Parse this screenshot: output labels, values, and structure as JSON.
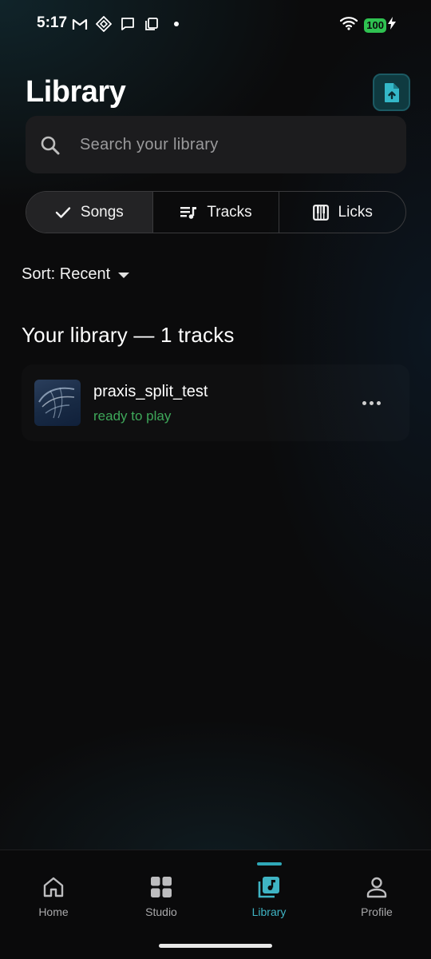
{
  "status_bar": {
    "time": "5:17",
    "battery": "100",
    "icons": [
      "gmail-icon",
      "diamond-app-icon",
      "message-icon",
      "copy-icon",
      "dot-icon",
      "wifi-icon",
      "battery-icon",
      "charging-icon"
    ]
  },
  "header": {
    "title": "Library",
    "upload_icon": "file-upload-icon"
  },
  "search": {
    "placeholder": "Search your library",
    "value": ""
  },
  "segments": [
    {
      "label": "Songs",
      "icon": "check-icon",
      "active": true
    },
    {
      "label": "Tracks",
      "icon": "playlist-music-icon",
      "active": false
    },
    {
      "label": "Licks",
      "icon": "piano-icon",
      "active": false
    }
  ],
  "sort": {
    "label": "Sort: Recent"
  },
  "library": {
    "heading": "Your library — 1 tracks",
    "tracks": [
      {
        "title": "praxis_split_test",
        "status": "ready to play"
      }
    ]
  },
  "nav": {
    "items": [
      {
        "label": "Home",
        "icon": "home-icon",
        "active": false
      },
      {
        "label": "Studio",
        "icon": "grid-icon",
        "active": false
      },
      {
        "label": "Library",
        "icon": "library-music-icon",
        "active": true
      },
      {
        "label": "Profile",
        "icon": "person-icon",
        "active": false
      }
    ]
  },
  "colors": {
    "accent": "#3fb4c4",
    "status_ready": "#3ea85a",
    "battery": "#2fc251"
  }
}
